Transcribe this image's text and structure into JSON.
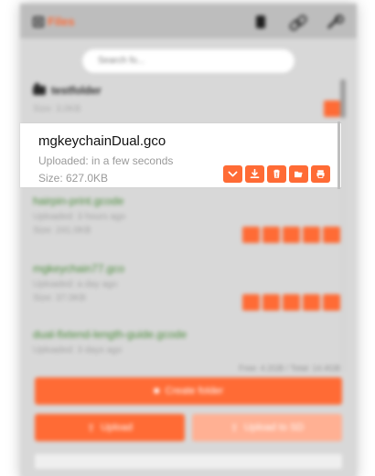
{
  "header": {
    "title": "Files",
    "icons": [
      "file-icon",
      "link-icon",
      "wrench-icon"
    ]
  },
  "search": {
    "placeholder": "Search fo..."
  },
  "folder": {
    "name": "testfolder",
    "size": "Size: 3.0KB"
  },
  "files": [
    {
      "name": "mgkeychainDual.gco",
      "uploaded": "Uploaded: in a few seconds",
      "size": "Size: 627.0KB"
    },
    {
      "name": "hairpin-print.gcode",
      "uploaded": "Uploaded: 3 hours ago",
      "size": "Size: 241.0KB"
    },
    {
      "name": "mgkeychain77.gco",
      "uploaded": "Uploaded: a day ago",
      "size": "Size: 37.0KB"
    },
    {
      "name": "dual-fixtend-length-guide.gcode",
      "uploaded": "Uploaded: 3 days ago",
      "size": ""
    }
  ],
  "footer": {
    "stats": "Free: 4.2GB / Total: 14.4GB",
    "create_folder_label": "Create folder",
    "upload_label": "Upload",
    "upload_sd_label": "Upload to SD"
  },
  "colors": {
    "accent": "#ff6b35",
    "accent_light": "#ffb093",
    "title_green": "#4c8d3d",
    "text_dark": "#111111",
    "text_muted": "#9a9a9a"
  }
}
